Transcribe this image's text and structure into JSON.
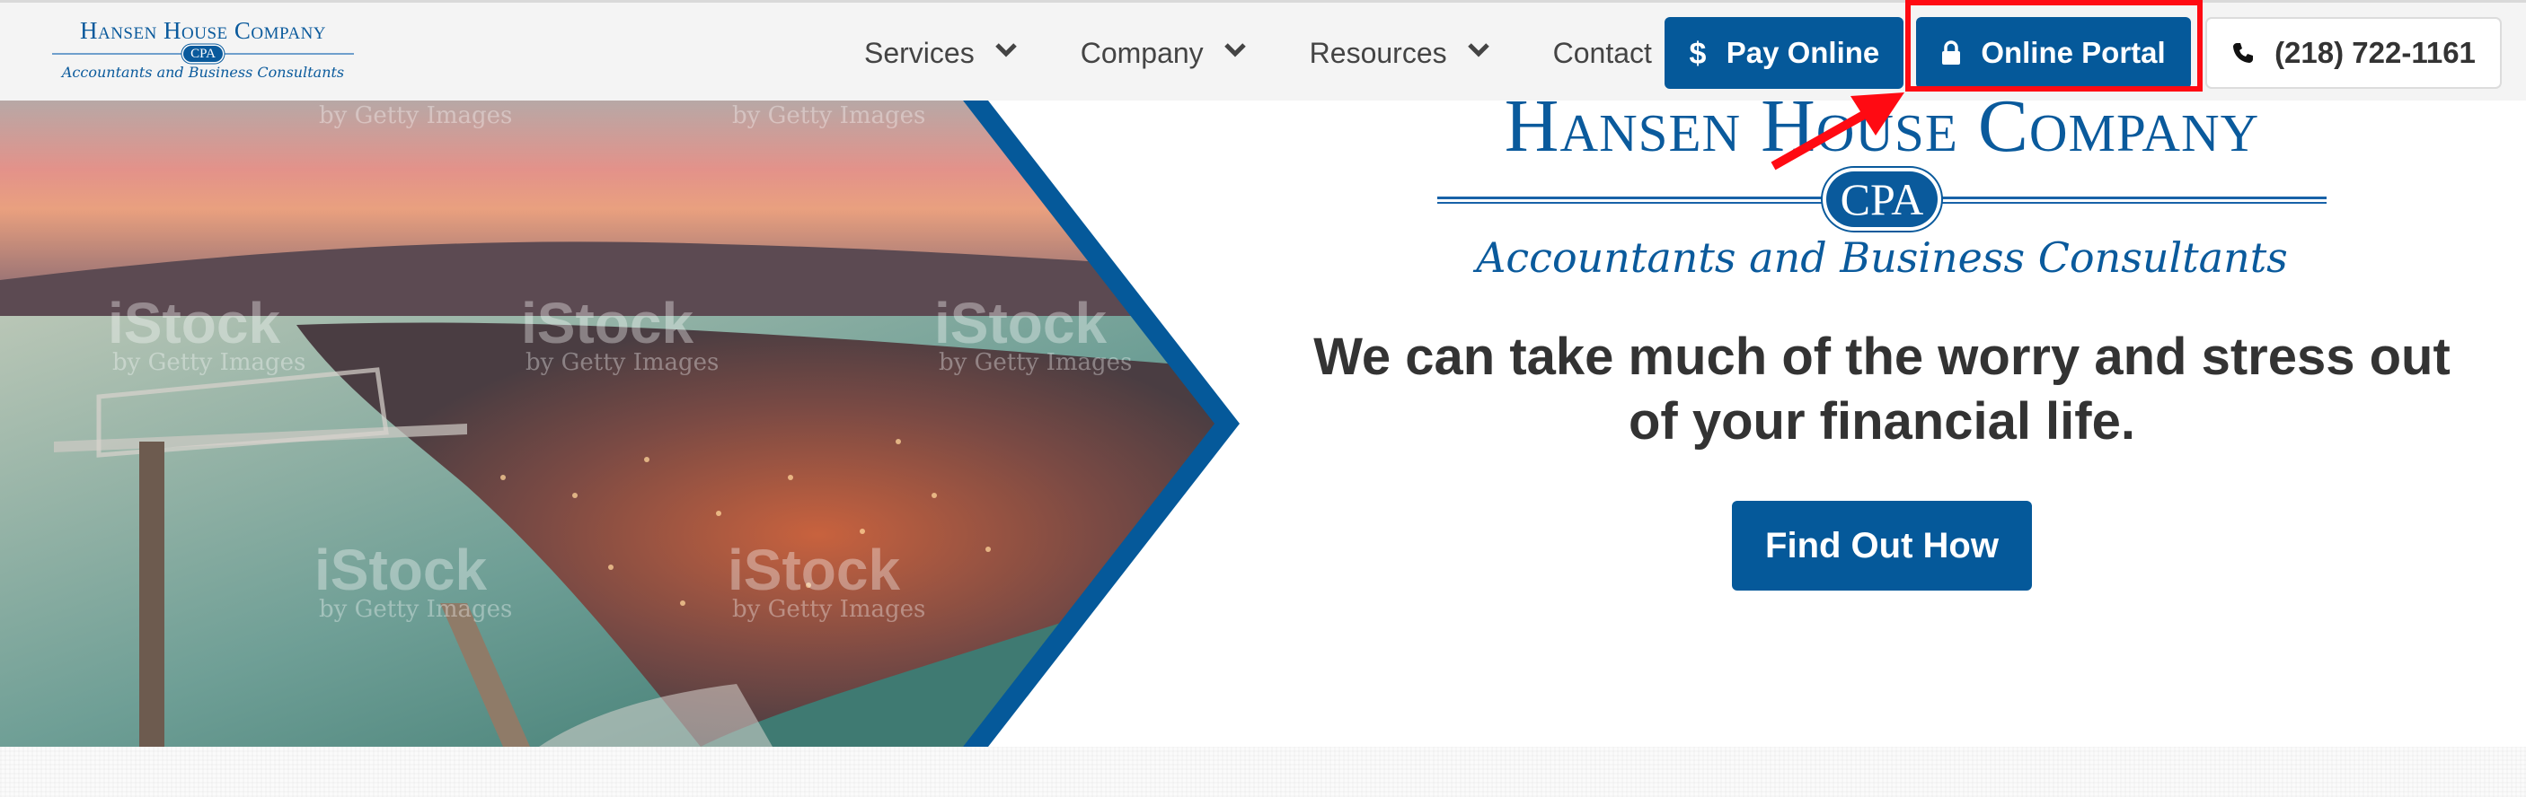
{
  "header": {
    "logo": {
      "title": "Hansen House Company",
      "badge": "CPA",
      "tagline": "Accountants and Business Consultants"
    },
    "nav": [
      {
        "label": "Services",
        "has_dropdown": true
      },
      {
        "label": "Company",
        "has_dropdown": true
      },
      {
        "label": "Resources",
        "has_dropdown": true
      },
      {
        "label": "Contact",
        "has_dropdown": false
      }
    ],
    "buttons": {
      "pay_online": {
        "label": "Pay Online",
        "icon": "dollar-icon"
      },
      "online_portal": {
        "label": "Online Portal",
        "icon": "lock-icon"
      },
      "phone": {
        "label": "(218) 722-1161",
        "icon": "phone-icon"
      }
    }
  },
  "annotation": {
    "highlight_target": "Online Portal",
    "color": "#ff0a12"
  },
  "hero": {
    "image": {
      "subject": "aerial view of Duluth harbor and lift bridge at sunset",
      "watermarks": [
        "iStock",
        "by Getty Images"
      ]
    },
    "logo": {
      "title": "Hansen House Company",
      "badge": "CPA",
      "tagline": "Accountants and Business Consultants"
    },
    "headline": "We can take much of the worry and stress out of your financial life.",
    "cta_label": "Find Out How"
  },
  "colors": {
    "brand_blue": "#05599a",
    "logo_blue": "#0a5a9c",
    "nav_text": "#444444",
    "headline_text": "#333333",
    "nav_bg": "#f4f4f4"
  }
}
